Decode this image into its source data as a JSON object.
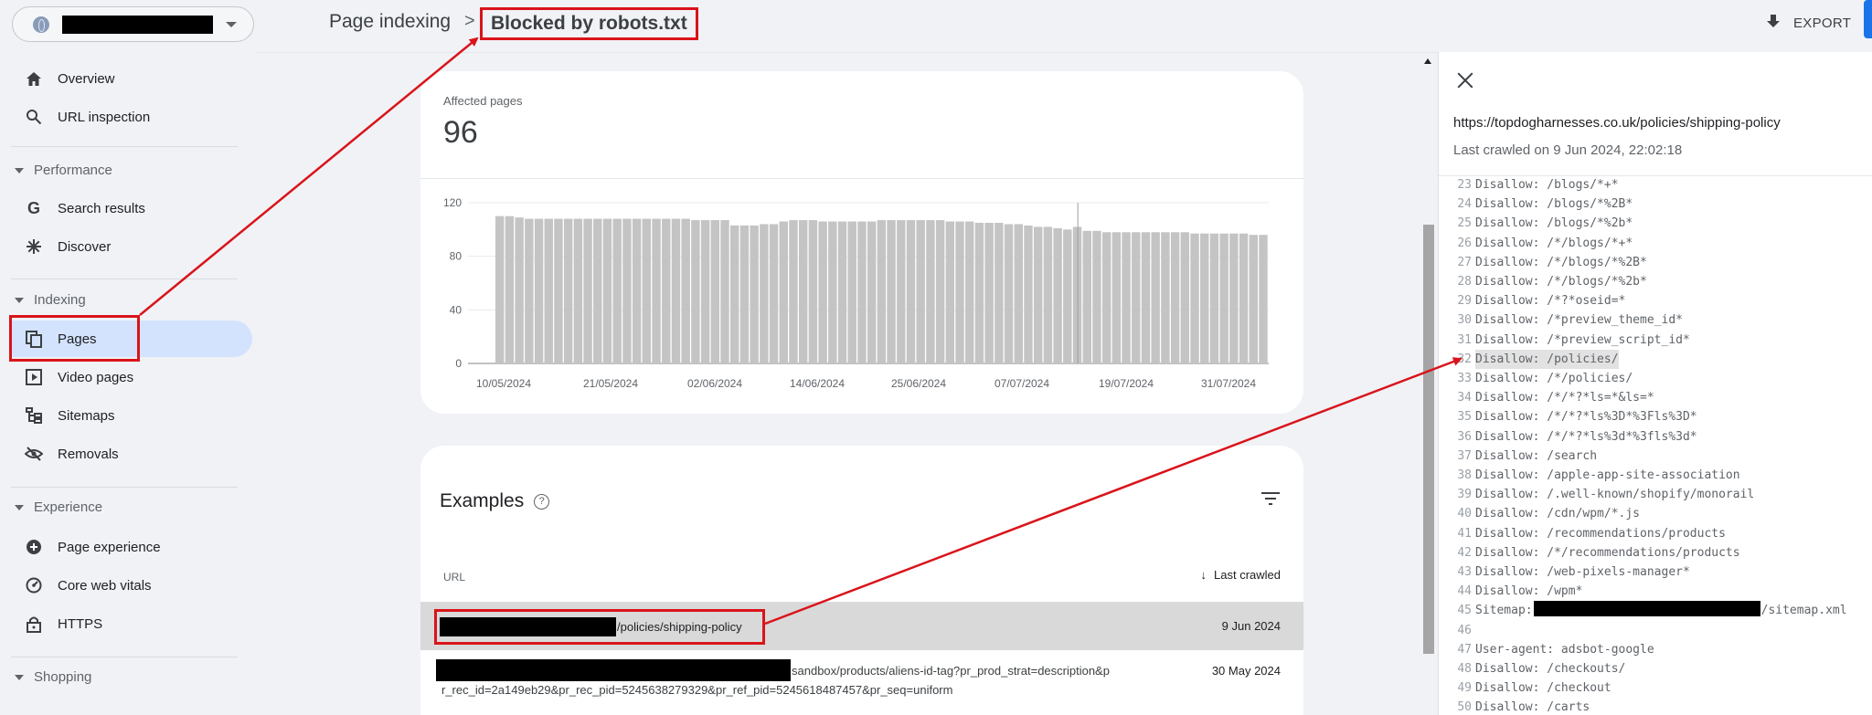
{
  "property": {
    "selector_caret": "chevron-down-icon"
  },
  "sidebar": {
    "top_items": [
      {
        "label": "Overview",
        "icon": "home-icon"
      },
      {
        "label": "URL inspection",
        "icon": "search-icon"
      }
    ],
    "sections": [
      {
        "label": "Performance",
        "items": [
          {
            "label": "Search results",
            "icon": "google-g-icon"
          },
          {
            "label": "Discover",
            "icon": "asterisk-icon"
          }
        ]
      },
      {
        "label": "Indexing",
        "items": [
          {
            "label": "Pages",
            "icon": "pages-icon",
            "active": true
          },
          {
            "label": "Video pages",
            "icon": "video-pages-icon"
          },
          {
            "label": "Sitemaps",
            "icon": "sitemap-icon"
          },
          {
            "label": "Removals",
            "icon": "eye-off-icon"
          }
        ]
      },
      {
        "label": "Experience",
        "items": [
          {
            "label": "Page experience",
            "icon": "plus-circle-icon"
          },
          {
            "label": "Core web vitals",
            "icon": "gauge-icon"
          },
          {
            "label": "HTTPS",
            "icon": "lock-icon"
          }
        ]
      },
      {
        "label": "Shopping",
        "items": []
      }
    ]
  },
  "header": {
    "breadcrumb_root": "Page indexing",
    "breadcrumb_sep": ">",
    "breadcrumb_current": "Blocked by robots.txt",
    "export_label": "EXPORT"
  },
  "summary": {
    "affected_label": "Affected pages",
    "affected_value": "96"
  },
  "chart_data": {
    "type": "bar",
    "y_ticks": [
      "0",
      "40",
      "80",
      "120"
    ],
    "ylim": [
      0,
      120
    ],
    "x_tick_labels": [
      "10/05/2024",
      "21/05/2024",
      "02/06/2024",
      "14/06/2024",
      "25/06/2024",
      "07/07/2024",
      "19/07/2024",
      "31/07/2024"
    ],
    "values": [
      110,
      110,
      109,
      108,
      108,
      108,
      108,
      108,
      108,
      108,
      108,
      108,
      108,
      108,
      108,
      108,
      108,
      108,
      108,
      108,
      107,
      107,
      107,
      107,
      103,
      103,
      103,
      104,
      104,
      106,
      107,
      107,
      107,
      106,
      106,
      106,
      106,
      106,
      106,
      107,
      107,
      107,
      107,
      107,
      107,
      107,
      106,
      106,
      106,
      105,
      105,
      105,
      104,
      104,
      103,
      102,
      102,
      101,
      100,
      102,
      99,
      99,
      98,
      98,
      98,
      98,
      98,
      98,
      98,
      98,
      98,
      97,
      97,
      97,
      97,
      97,
      97,
      96,
      96
    ]
  },
  "examples": {
    "title": "Examples",
    "col_url": "URL",
    "col_crawled": "Last crawled",
    "rows": [
      {
        "path": "/policies/shipping-policy",
        "date": "9 Jun 2024"
      },
      {
        "path_line1": "sandbox/products/aliens-id-tag?pr_prod_strat=description&p",
        "path_line2": "r_rec_id=2a149eb29&pr_rec_pid=5245638279329&pr_ref_pid=5245618487457&pr_seq=uniform",
        "date": "30 May 2024"
      }
    ]
  },
  "panel": {
    "url": "https://topdogharnesses.co.uk/policies/shipping-policy",
    "last_crawled": "Last crawled on 9 Jun 2024, 22:02:18",
    "code": [
      {
        "n": "23",
        "t": "Disallow: /blogs/*+*"
      },
      {
        "n": "24",
        "t": "Disallow: /blogs/*%2B*"
      },
      {
        "n": "25",
        "t": "Disallow: /blogs/*%2b*"
      },
      {
        "n": "26",
        "t": "Disallow: /*/blogs/*+*"
      },
      {
        "n": "27",
        "t": "Disallow: /*/blogs/*%2B*"
      },
      {
        "n": "28",
        "t": "Disallow: /*/blogs/*%2b*"
      },
      {
        "n": "29",
        "t": "Disallow: /*?*oseid=*"
      },
      {
        "n": "30",
        "t": "Disallow: /*preview_theme_id*"
      },
      {
        "n": "31",
        "t": "Disallow: /*preview_script_id*"
      },
      {
        "n": "32",
        "t": "Disallow: /policies/",
        "hl": true
      },
      {
        "n": "33",
        "t": "Disallow: /*/policies/"
      },
      {
        "n": "34",
        "t": "Disallow: /*/*?*ls=*&ls=*"
      },
      {
        "n": "35",
        "t": "Disallow: /*/*?*ls%3D*%3Fls%3D*"
      },
      {
        "n": "36",
        "t": "Disallow: /*/*?*ls%3d*%3fls%3d*"
      },
      {
        "n": "37",
        "t": "Disallow: /search"
      },
      {
        "n": "38",
        "t": "Disallow: /apple-app-site-association"
      },
      {
        "n": "39",
        "t": "Disallow: /.well-known/shopify/monorail"
      },
      {
        "n": "40",
        "t": "Disallow: /cdn/wpm/*.js"
      },
      {
        "n": "41",
        "t": "Disallow: /recommendations/products"
      },
      {
        "n": "42",
        "t": "Disallow: /*/recommendations/products"
      },
      {
        "n": "43",
        "t": "Disallow: /web-pixels-manager*"
      },
      {
        "n": "44",
        "t": "Disallow: /wpm*"
      },
      {
        "n": "45",
        "t": "Sitemap:",
        "t2": "/sitemap.xml",
        "redact": true
      },
      {
        "n": "46",
        "t": ""
      },
      {
        "n": "47",
        "t": "User-agent: adsbot-google"
      },
      {
        "n": "48",
        "t": "Disallow: /checkouts/"
      },
      {
        "n": "49",
        "t": "Disallow: /checkout"
      },
      {
        "n": "50",
        "t": "Disallow: /carts"
      }
    ]
  },
  "colors": {
    "accent": "#1a73e8",
    "annotation": "#d9141a",
    "bar": "#c4c4c4",
    "active_nav": "#d3e3fd"
  }
}
